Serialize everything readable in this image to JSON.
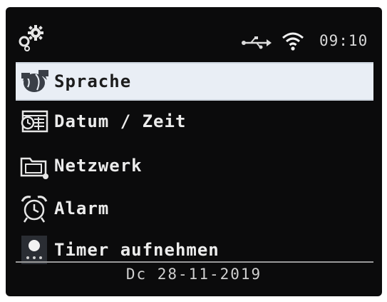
{
  "status_bar": {
    "settings_icon": "settings-gears-icon",
    "usb_icon": "usb-icon",
    "wifi_icon": "wifi-icon",
    "time": "09:10"
  },
  "menu": {
    "selected_index": 0,
    "items": [
      {
        "label": "Sprache",
        "icon": "globe-speech-icon"
      },
      {
        "label": "Datum / Zeit",
        "icon": "calendar-clock-icon"
      },
      {
        "label": "Netzwerk",
        "icon": "network-folder-icon"
      },
      {
        "label": "Alarm",
        "icon": "alarm-clock-icon"
      },
      {
        "label": "Timer aufnehmen",
        "icon": "record-timer-icon"
      }
    ]
  },
  "footer": {
    "date_text": "Dc 28-11-2019"
  },
  "colors": {
    "screen_background": "#0b0b0c",
    "selected_background": "#e9eef5",
    "text": "#ececec"
  }
}
